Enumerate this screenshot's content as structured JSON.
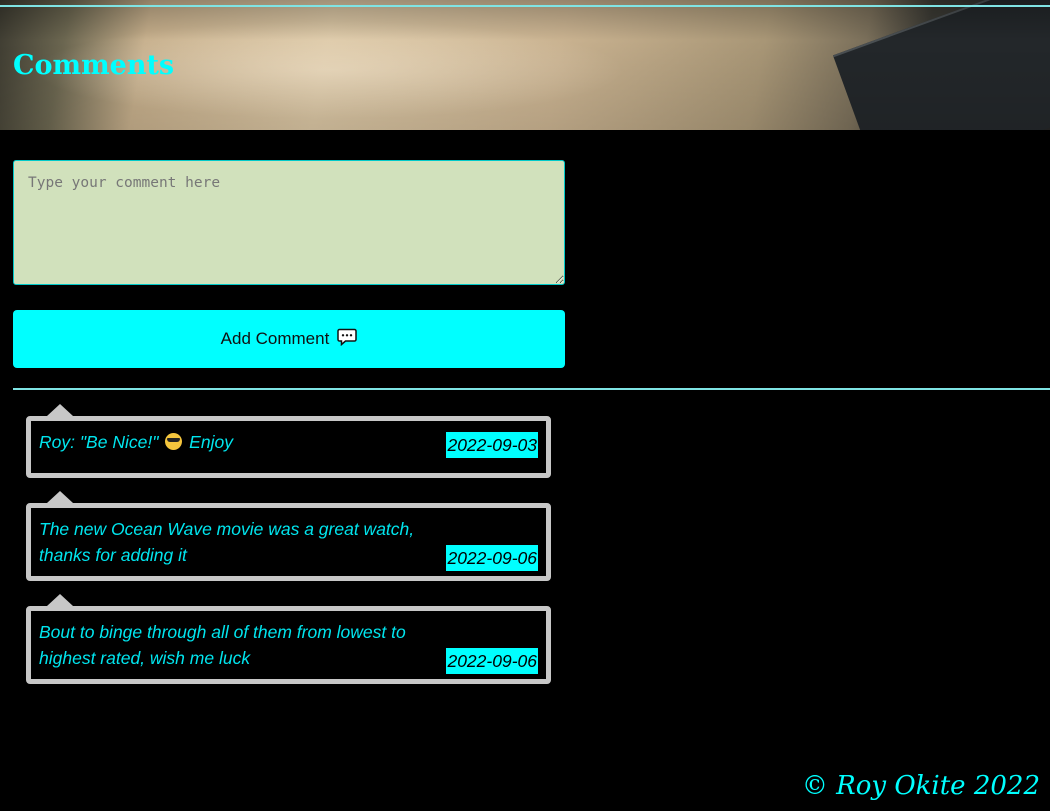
{
  "header": {
    "title": "Comments"
  },
  "form": {
    "placeholder": "Type your comment here",
    "button_label": "Add Comment",
    "button_icon": "speech-bubble-icon"
  },
  "comments": [
    {
      "author": "Roy",
      "text_before": ": \"Be Nice!\"",
      "emoji": "smiling-face-with-sunglasses",
      "text_after": "Enjoy",
      "date": "2022-09-03"
    },
    {
      "text": "The new Ocean Wave movie was a great watch, thanks for adding it",
      "date": "2022-09-06"
    },
    {
      "text": "Bout to binge through all of them from lowest to highest rated, wish me luck",
      "date": "2022-09-06"
    }
  ],
  "footer": {
    "text": "© Roy Okite 2022"
  },
  "colors": {
    "accent": "#00ffff",
    "textarea_bg": "#d1e1bc",
    "bubble_border": "#c7c7c7",
    "background": "#000000"
  }
}
